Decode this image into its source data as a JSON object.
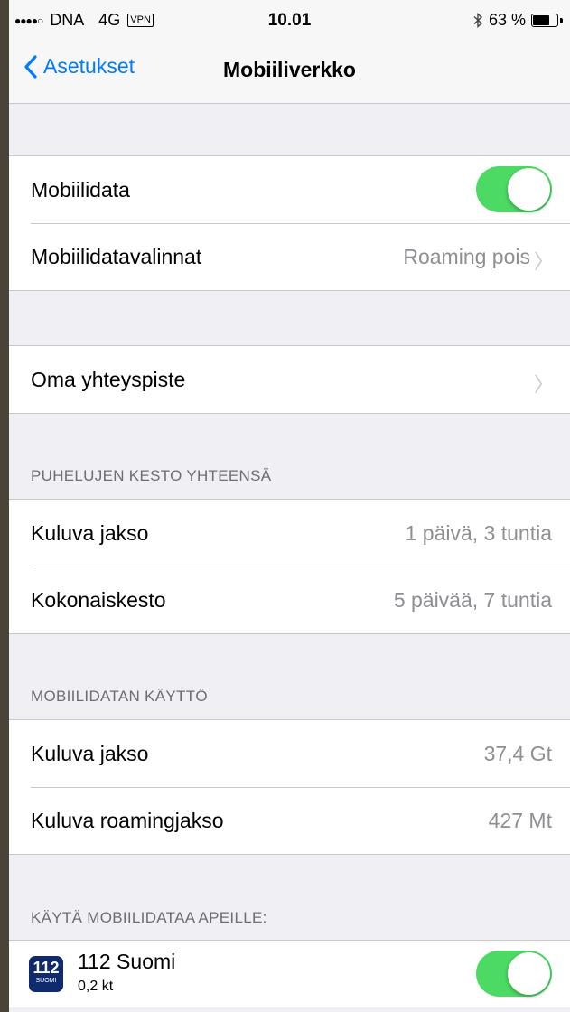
{
  "status_bar": {
    "signal": "●●●●○",
    "carrier": "DNA",
    "network": "4G",
    "vpn": "VPN",
    "time": "10.01",
    "bluetooth": "bluetooth-icon",
    "battery": "63 %",
    "battery_level": 0.63
  },
  "nav": {
    "back_label": "Asetukset",
    "title": "Mobiiliverkko"
  },
  "group1": {
    "mobile_data_label": "Mobiilidata",
    "mobile_data_on": true,
    "options_label": "Mobiilidatavalinnat",
    "options_value": "Roaming pois"
  },
  "group2": {
    "hotspot_label": "Oma yhteyspiste"
  },
  "calls": {
    "header": "PUHELUJEN KESTO YHTEENSÄ",
    "current_label": "Kuluva jakso",
    "current_value": "1 päivä, 3 tuntia",
    "total_label": "Kokonaiskesto",
    "total_value": "5 päivää, 7 tuntia"
  },
  "data_usage": {
    "header": "MOBIILIDATAN KÄYTTÖ",
    "current_label": "Kuluva jakso",
    "current_value": "37,4 Gt",
    "roaming_label": "Kuluva roamingjakso",
    "roaming_value": "427 Mt"
  },
  "apps": {
    "header": "KÄYTÄ MOBIILIDATAA APEILLE:",
    "items": [
      {
        "icon_text": "112",
        "icon_sub": "SUOMI",
        "name": "112 Suomi",
        "size": "0,2 kt",
        "enabled": true
      }
    ]
  },
  "colors": {
    "accent": "#007aff",
    "toggle_on": "#4cd964",
    "background": "#efeff4",
    "secondary_text": "#8e8e93"
  }
}
